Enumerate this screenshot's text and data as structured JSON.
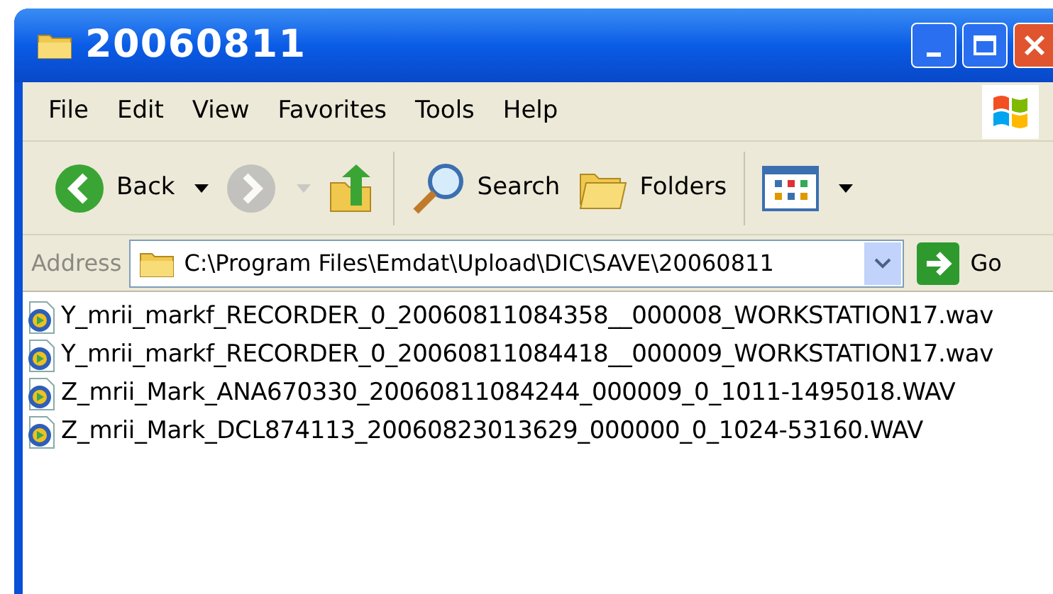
{
  "window": {
    "title": "20060811"
  },
  "menu": [
    "File",
    "Edit",
    "View",
    "Favorites",
    "Tools",
    "Help"
  ],
  "toolbar": [
    {
      "kind": "back",
      "label": "Back",
      "disabled": false
    },
    {
      "kind": "forward",
      "disabled": true
    },
    {
      "kind": "up",
      "disabled": false
    },
    {
      "kind": "search",
      "label": "Search",
      "disabled": false
    },
    {
      "kind": "folders",
      "label": "Folders",
      "disabled": false
    },
    {
      "kind": "views",
      "disabled": false
    }
  ],
  "address": {
    "label": "Address",
    "value": "C:\\Program Files\\Emdat\\Upload\\DIC\\SAVE\\20060811",
    "go": "Go"
  },
  "files": [
    {
      "name": "Y_mrii_markf_RECORDER_0_20060811084358__000008_WORKSTATION17.wav"
    },
    {
      "name": "Y_mrii_markf_RECORDER_0_20060811084418__000009_WORKSTATION17.wav"
    },
    {
      "name": "Z_mrii_Mark_ANA670330_20060811084244_000009_0_1011-1495018.WAV"
    },
    {
      "name": "Z_mrii_Mark_DCL874113_20060823013629_000000_0_1024-53160.WAV"
    }
  ]
}
